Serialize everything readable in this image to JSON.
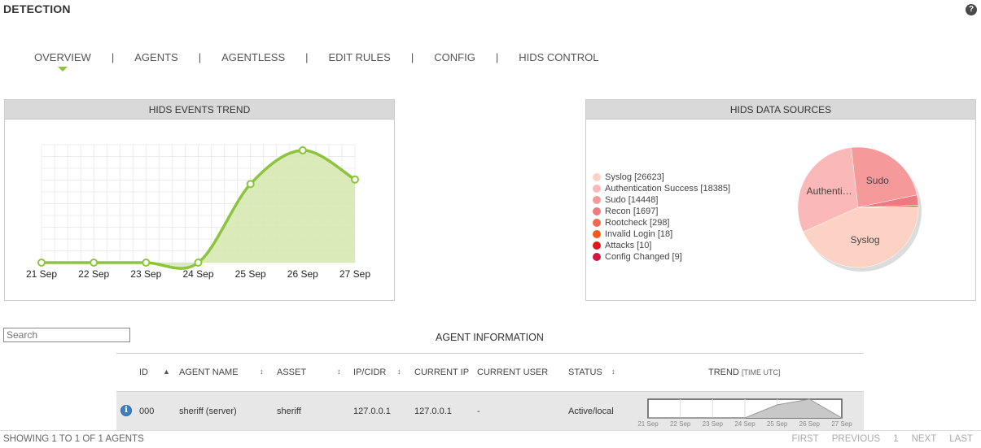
{
  "header": {
    "title": "DETECTION",
    "help_glyph": "?"
  },
  "tabs": [
    {
      "label": "OVERVIEW",
      "active": true
    },
    {
      "label": "AGENTS"
    },
    {
      "label": "AGENTLESS"
    },
    {
      "label": "EDIT RULES"
    },
    {
      "label": "CONFIG"
    },
    {
      "label": "HIDS CONTROL"
    }
  ],
  "tab_separator": "|",
  "colors": {
    "accent": "#8dc43f",
    "area_fill": "#d6e8b0"
  },
  "trend_panel": {
    "title": "HIDS EVENTS TREND",
    "chart_data": {
      "type": "area",
      "categories": [
        "21 Sep",
        "22 Sep",
        "23 Sep",
        "24 Sep",
        "25 Sep",
        "26 Sep",
        "27 Sep"
      ],
      "values": [
        0,
        0,
        0,
        0,
        0.7,
        1.0,
        0.74
      ],
      "ylim": [
        0,
        1.05
      ],
      "grid": true,
      "xlabel": "",
      "ylabel": "",
      "title": "HIDS EVENTS TREND"
    }
  },
  "sources_panel": {
    "title": "HIDS DATA SOURCES",
    "legend": [
      {
        "label": "Syslog [26623]",
        "color": "#fcd2c4"
      },
      {
        "label": "Authentication Success [18385]",
        "color": "#fbb8b8"
      },
      {
        "label": "Sudo [14448]",
        "color": "#f6999b"
      },
      {
        "label": "Recon [1697]",
        "color": "#ec7a7e"
      },
      {
        "label": "Rootcheck [298]",
        "color": "#ef6a50"
      },
      {
        "label": "Invalid Login [18]",
        "color": "#f15a1e"
      },
      {
        "label": "Attacks [10]",
        "color": "#e2161a"
      },
      {
        "label": "Config Changed [9]",
        "color": "#cf1744"
      }
    ],
    "chart_data": {
      "type": "pie",
      "categories": [
        "Syslog",
        "Authentication Success",
        "Sudo",
        "Recon",
        "Rootcheck",
        "Invalid Login",
        "Attacks",
        "Config Changed"
      ],
      "values": [
        26623,
        18385,
        14448,
        1697,
        298,
        18,
        10,
        9
      ],
      "slice_labels": [
        "Syslog",
        "Authenti…",
        "Sudo",
        "",
        "",
        "",
        "",
        ""
      ],
      "title": "HIDS DATA SOURCES"
    }
  },
  "table": {
    "search_placeholder": "Search",
    "title": "AGENT INFORMATION",
    "columns": {
      "id": "ID",
      "agent_name": "AGENT NAME",
      "asset": "ASSET",
      "ip": "IP/CIDR",
      "current_ip": "CURRENT IP",
      "current_user": "CURRENT USER",
      "status": "STATUS",
      "trend": "TREND",
      "trend_sub": "[TIME UTC]"
    },
    "sort_glyph": "↕",
    "sort_up_glyph": "▲",
    "rows": [
      {
        "id": "000",
        "agent_name": "sheriff (server)",
        "asset": "sheriff",
        "ip": "127.0.0.1",
        "current_ip": "127.0.0.1",
        "current_user": "-",
        "status": "Active/local",
        "trend": {
          "categories": [
            "21 Sep",
            "22 Sep",
            "23 Sep",
            "24 Sep",
            "25 Sep",
            "26 Sep",
            "27 Sep"
          ],
          "values": [
            0,
            0,
            0,
            0,
            0.7,
            1.0,
            0.0
          ]
        }
      }
    ]
  },
  "footer": {
    "showing": "SHOWING 1 TO 1 OF 1 AGENTS",
    "first": "FIRST",
    "previous": "PREVIOUS",
    "page": "1",
    "next": "NEXT",
    "last": "LAST"
  }
}
